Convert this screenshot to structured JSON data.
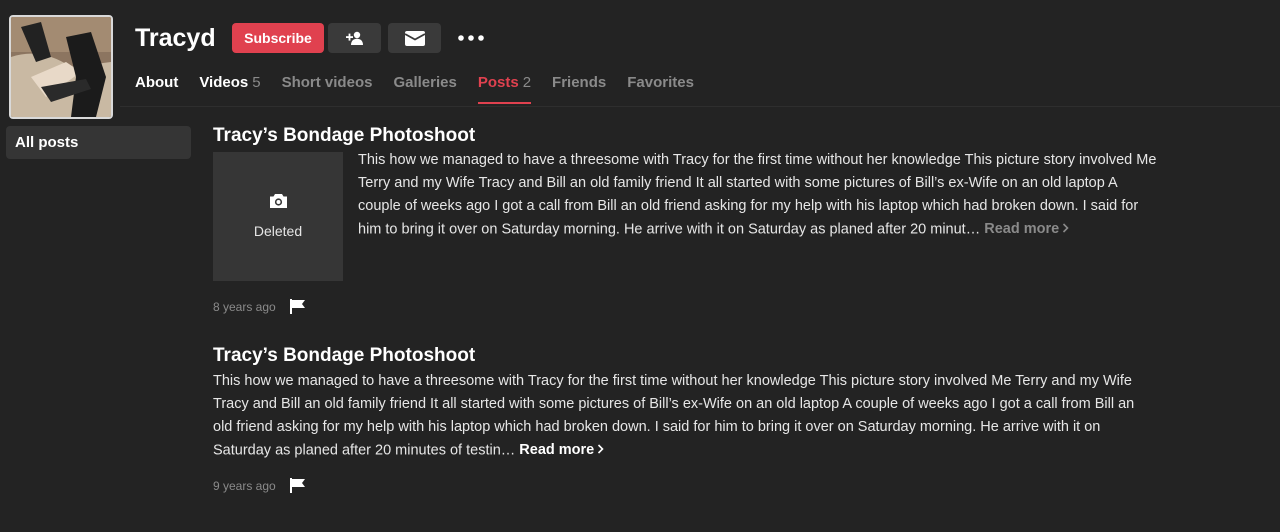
{
  "profile": {
    "username": "Tracyd",
    "subscribe_label": "Subscribe"
  },
  "icons": {
    "add_friend": "add-friend-icon",
    "message": "envelope-icon",
    "more": "more-dots-icon",
    "camera": "camera-icon",
    "flag": "flag-icon",
    "chevron": "chevron-right-icon"
  },
  "colors": {
    "accent": "#e0414f",
    "background": "#232323",
    "muted": "#8a8a8a"
  },
  "tabs": [
    {
      "label": "About",
      "count": ""
    },
    {
      "label": "Videos",
      "count": "5"
    },
    {
      "label": "Short videos",
      "count": ""
    },
    {
      "label": "Galleries",
      "count": ""
    },
    {
      "label": "Posts",
      "count": "2"
    },
    {
      "label": "Friends",
      "count": ""
    },
    {
      "label": "Favorites",
      "count": ""
    }
  ],
  "sidebar": {
    "items": [
      {
        "label": "All posts"
      }
    ]
  },
  "posts": [
    {
      "title": "Tracy’s Bondage Photoshoot",
      "thumbnail_status": "Deleted",
      "excerpt": "This how we managed to have a threesome with Tracy for the first time without her knowledge This picture story involved Me Terry and my Wife Tracy and Bill an old family friend It all started with some pictures of Bill’s ex-Wife on an old laptop A couple of weeks ago I got a call from Bill an old friend asking for my help with his laptop which had broken down. I said for him to bring it over on Saturday morning. He arrive with it on Saturday as planed after 20 minut…",
      "read_more": "Read more",
      "time": "8 years ago"
    },
    {
      "title": "Tracy’s Bondage Photoshoot",
      "excerpt": "This how we managed to have a threesome with Tracy for the first time without her knowledge This picture story involved Me Terry and my Wife Tracy and Bill an old family friend It all started with some pictures of Bill’s ex-Wife on an old laptop A couple of weeks ago I got a call from Bill an old friend asking for my help with his laptop which had broken down. I said for him to bring it over on Saturday morning. He arrive with it on Saturday as planed after 20 minutes of testin…",
      "read_more": "Read more",
      "time": "9 years ago"
    }
  ]
}
